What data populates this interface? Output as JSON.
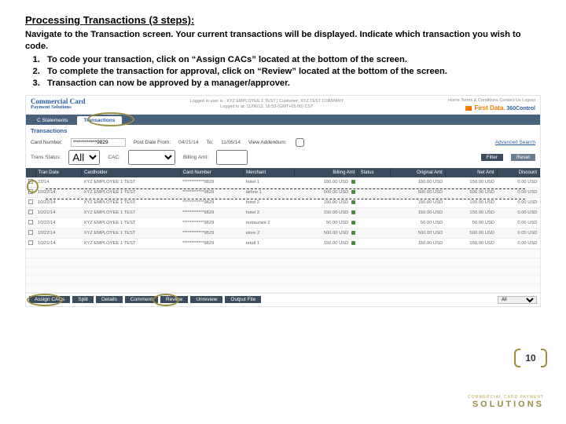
{
  "heading": "Processing Transactions (3 steps):",
  "intro": "Navigate to the Transaction screen.  Your current transactions will be displayed. Indicate which transaction you wish to code.",
  "steps": [
    "To code your transaction, click on “Assign CACs” located at the bottom of the screen.",
    "To complete the transaction for approval, click on “Review” located at the bottom of the screen.",
    "Transaction can now be approved by a manager/approver."
  ],
  "app": {
    "brand1": "Commercial Card",
    "brand2": "Payment Solutions",
    "loginLine1": "Logged in user is :  XYZ EMPLOYEE 1 TEST | Customer: XYZ TEST COMPANY",
    "loginLine2": "Logged in at: 11/06/13, 16:53-(GMT+05:00) CST",
    "topLinks": "Home   Terms & Conditions   Contact Us   Logout",
    "fd": "First Data.",
    "ctrl": "360Control",
    "tabs": [
      "C Statements",
      "Transactions"
    ],
    "activeTab": 1,
    "sectionTitle": "Transactions",
    "filters": {
      "cardLabel": "Card Number:",
      "cardValue": "************9829",
      "postFromLabel": "Post Date From:",
      "postFromValue": "04/21/14",
      "postToLabel": "To:",
      "postToValue": "11/06/14",
      "viewLabel": "View Addendum:",
      "adv": "Advanced Search"
    },
    "filters2": {
      "transStatusLabel": "Trans Status:",
      "transStatusValue": "All",
      "cacLabel": "CAC:",
      "billingLabel": "Billing Amt:",
      "filterBtn": "Filter",
      "resetBtn": "Reset"
    },
    "columns": [
      "",
      "Tran Date",
      "Cardholder",
      "Card Number",
      "Merchant",
      "Billing Amt",
      "Status",
      "Original Amt",
      "Net Amt",
      "Discount"
    ],
    "rows": [
      {
        "date": "22/14",
        "holder": "XYZ EMPLOYEE 1 TEST",
        "card": "************9829",
        "merchant": "hotel 1",
        "amt": "150.00 USD",
        "orig": "150.00 USD",
        "net": "150.00 USD",
        "disc": "0.00 USD"
      },
      {
        "date": "10/22/14",
        "holder": "XYZ EMPLOYEE 1 TEST",
        "card": "************9829",
        "merchant": "airline 1",
        "amt": "500.00 USD",
        "orig": "500.00 USD",
        "net": "500.00 USD",
        "disc": "0.00 USD"
      },
      {
        "date": "10/22/14",
        "holder": "XYZ EMPLOYEE 1 TEST",
        "card": "************9829",
        "merchant": "hotel 2",
        "amt": "150.00 USD",
        "orig": "150.00 USD",
        "net": "150.00 USD",
        "disc": "0.00 USD"
      },
      {
        "date": "10/21/14",
        "holder": "XYZ EMPLOYEE 1 TEST",
        "card": "************9829",
        "merchant": "hotel 3",
        "amt": "150.00 USD",
        "orig": "150.00 USD",
        "net": "150.00 USD",
        "disc": "0.00 USD"
      },
      {
        "date": "10/22/14",
        "holder": "XYZ EMPLOYEE 1 TEST",
        "card": "************9829",
        "merchant": "restaurant 2",
        "amt": "50.00 USD",
        "orig": "50.00 USD",
        "net": "50.00 USD",
        "disc": "0.00 USD"
      },
      {
        "date": "10/22/14",
        "holder": "XYZ EMPLOYEE 1 TEST",
        "card": "************9829",
        "merchant": "store 2",
        "amt": "500.00 USD",
        "orig": "500.00 USD",
        "net": "500.00 USD",
        "disc": "0.00 USD"
      },
      {
        "date": "10/21/14",
        "holder": "XYZ EMPLOYEE 1 TEST",
        "card": "************9829",
        "merchant": "retail 1",
        "amt": "150.00 USD",
        "orig": "150.00 USD",
        "net": "150.00 USD",
        "disc": "0.00 USD"
      }
    ],
    "bottomButtons": [
      "Assign CACs",
      "Split",
      "Details",
      "Comment",
      "Review",
      "Unreview",
      "Output File"
    ],
    "pageSel": "All"
  },
  "pageNumber": "10",
  "footer": {
    "line1": "COMMERCIAL CARD PAYMENT",
    "line2": "SOLUTIONS"
  }
}
